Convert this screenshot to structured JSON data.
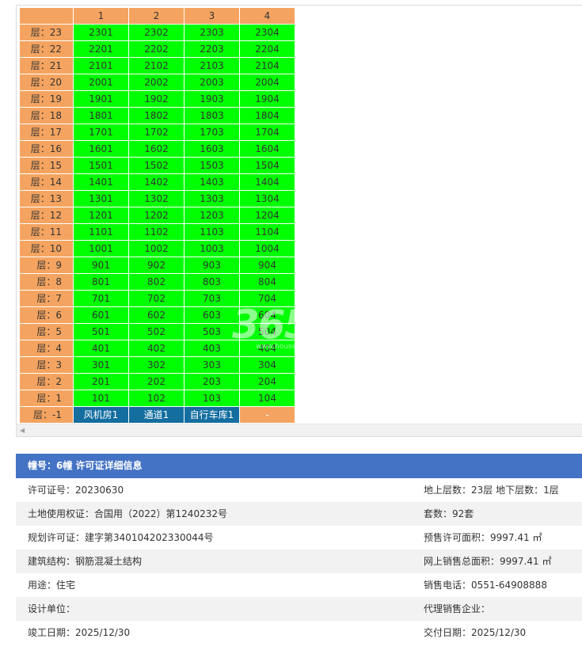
{
  "unit_table": {
    "columns": [
      "1",
      "2",
      "3",
      "4"
    ],
    "floors": [
      {
        "label": "层：23",
        "units": [
          "2301",
          "2302",
          "2303",
          "2304"
        ]
      },
      {
        "label": "层：22",
        "units": [
          "2201",
          "2202",
          "2203",
          "2204"
        ]
      },
      {
        "label": "层：21",
        "units": [
          "2101",
          "2102",
          "2103",
          "2104"
        ]
      },
      {
        "label": "层：20",
        "units": [
          "2001",
          "2002",
          "2003",
          "2004"
        ]
      },
      {
        "label": "层：19",
        "units": [
          "1901",
          "1902",
          "1903",
          "1904"
        ]
      },
      {
        "label": "层：18",
        "units": [
          "1801",
          "1802",
          "1803",
          "1804"
        ]
      },
      {
        "label": "层：17",
        "units": [
          "1701",
          "1702",
          "1703",
          "1704"
        ]
      },
      {
        "label": "层：16",
        "units": [
          "1601",
          "1602",
          "1603",
          "1604"
        ]
      },
      {
        "label": "层：15",
        "units": [
          "1501",
          "1502",
          "1503",
          "1504"
        ]
      },
      {
        "label": "层：14",
        "units": [
          "1401",
          "1402",
          "1403",
          "1404"
        ]
      },
      {
        "label": "层：13",
        "units": [
          "1301",
          "1302",
          "1303",
          "1304"
        ]
      },
      {
        "label": "层：12",
        "units": [
          "1201",
          "1202",
          "1203",
          "1204"
        ]
      },
      {
        "label": "层：11",
        "units": [
          "1101",
          "1102",
          "1103",
          "1104"
        ]
      },
      {
        "label": "层：10",
        "units": [
          "1001",
          "1002",
          "1003",
          "1004"
        ]
      },
      {
        "label": "层：9",
        "units": [
          "901",
          "902",
          "903",
          "904"
        ]
      },
      {
        "label": "层：8",
        "units": [
          "801",
          "802",
          "803",
          "804"
        ]
      },
      {
        "label": "层：7",
        "units": [
          "701",
          "702",
          "703",
          "704"
        ]
      },
      {
        "label": "层：6",
        "units": [
          "601",
          "602",
          "603",
          "604"
        ]
      },
      {
        "label": "层：5",
        "units": [
          "501",
          "502",
          "503",
          "504"
        ]
      },
      {
        "label": "层：4",
        "units": [
          "401",
          "402",
          "403",
          "404"
        ]
      },
      {
        "label": "层：3",
        "units": [
          "301",
          "302",
          "303",
          "304"
        ]
      },
      {
        "label": "层：2",
        "units": [
          "201",
          "202",
          "203",
          "204"
        ]
      },
      {
        "label": "层：1",
        "units": [
          "101",
          "102",
          "103",
          "104"
        ]
      }
    ],
    "basement": {
      "label": "层：-1",
      "units": [
        "风机房1",
        "通道1",
        "自行车库1",
        "-"
      ]
    }
  },
  "watermark": {
    "big": "365",
    "small": "www.house365.com"
  },
  "permit": {
    "header": "幢号：6幢 许可证详细信息",
    "rows": [
      {
        "left": "许可证号：20230630",
        "right": "地上层数：23层  地下层数：1层"
      },
      {
        "left": "土地使用权证：合国用（2022）第1240232号",
        "right": "套数：92套"
      },
      {
        "left": "规划许可证：建字第340104202330044号",
        "right": "预售许可面积：9997.41 ㎡"
      },
      {
        "left": "建筑结构：钢筋混凝土结构",
        "right": "网上销售总面积：9997.41 ㎡"
      },
      {
        "left": "用途：住宅",
        "right": "销售电话：0551-64908888"
      },
      {
        "left": "设计单位：",
        "right": "代理销售企业："
      },
      {
        "left": "竣工日期：2025/12/30",
        "right": "交付日期：2025/12/30"
      }
    ]
  },
  "colors": {
    "header_orange": "#f4a460",
    "unit_green": "#00ff00",
    "basement_blue": "#146ea0",
    "permit_header_blue": "#4472c4",
    "row_shade": "#f2f2f2"
  },
  "icons": {
    "scroll_left": "left-arrow-icon"
  }
}
